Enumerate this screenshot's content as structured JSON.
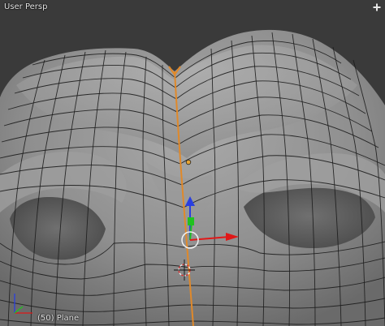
{
  "viewport": {
    "view_label": "User Persp",
    "object_label": "(50) Plane",
    "menu_icon": "plus-icon"
  },
  "colors": {
    "background": "#3a3a3a",
    "mesh_fill": "#8e8e8e",
    "wire": "#1c1c1c",
    "selected_edge": "#e0892a",
    "transform_red": "#e01818",
    "transform_green": "#1fc21f",
    "transform_blue": "#2a3fe0"
  }
}
